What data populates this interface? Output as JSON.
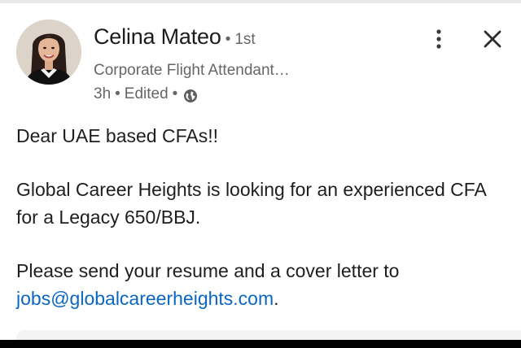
{
  "author": {
    "name": "Celina Mateo",
    "connection_degree": "1st",
    "headline": "Corporate Flight Attendant…",
    "time_ago": "3h",
    "edited_label": "Edited",
    "separator": "•",
    "visibility_icon": "globe-icon"
  },
  "actions": {
    "more_icon": "more-vertical-icon",
    "close_icon": "close-icon"
  },
  "post": {
    "greeting": "Dear UAE based CFAs!!",
    "paragraph_1": "Global Career Heights is looking for an experienced CFA for a Legacy 650/BBJ.",
    "paragraph_2_prefix": "Please send your resume and a cover letter to ",
    "email": "jobs@globalcareerheights.com",
    "paragraph_2_suffix": "."
  },
  "colors": {
    "link": "#0a66c2",
    "secondary_text": "#666666",
    "primary_text": "#1e1e1e"
  }
}
